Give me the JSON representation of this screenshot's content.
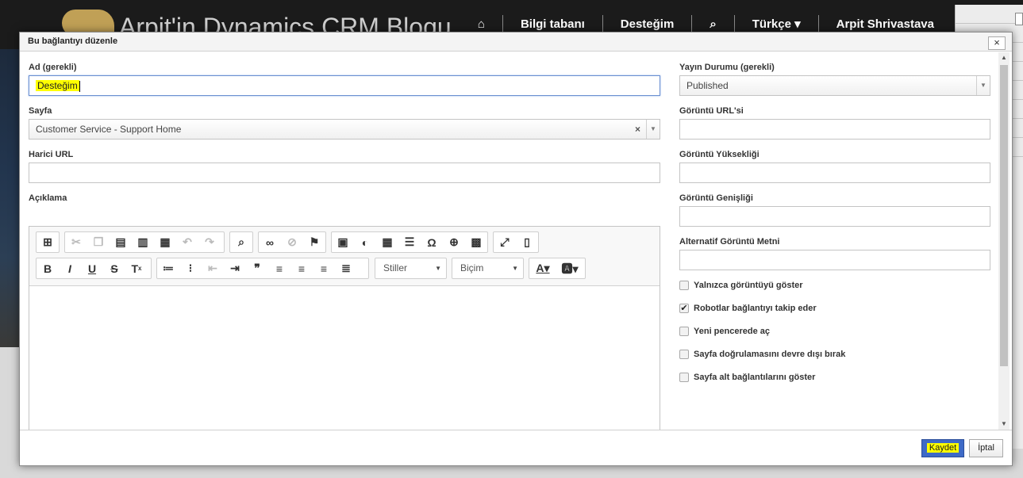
{
  "site": {
    "title": "Arpit'in Dynamics CRM Blogu",
    "nav": [
      "⌂",
      "Bilgi tabanı",
      "Desteğim",
      "⌕",
      "Türkçe ▾",
      "Arpit Shrivastava"
    ]
  },
  "dialog": {
    "title": "Bu bağlantıyı düzenle",
    "close": "×",
    "left": {
      "name_label": "Ad (gerekli)",
      "name_value": "Desteğim",
      "page_label": "Sayfa",
      "page_value": "Customer Service - Support Home",
      "page_clear": "×",
      "external_label": "Harici URL",
      "external_value": "",
      "description_label": "Açıklama"
    },
    "right": {
      "status_label": "Yayın Durumu (gerekli)",
      "status_value": "Published",
      "image_url_label": "Görüntü URL'si",
      "image_height_label": "Görüntü Yüksekliği",
      "image_width_label": "Görüntü Genişliği",
      "alt_text_label": "Alternatif Görüntü Metni",
      "checkboxes": [
        {
          "label": "Yalnızca görüntüyü göster",
          "checked": false
        },
        {
          "label": "Robotlar bağlantıyı takip eder",
          "checked": true
        },
        {
          "label": "Yeni pencerede aç",
          "checked": false
        },
        {
          "label": "Sayfa doğrulamasını devre dışı bırak",
          "checked": false
        },
        {
          "label": "Sayfa alt bağlantılarını göster",
          "checked": false
        }
      ]
    },
    "editor": {
      "styles_label": "Stiller",
      "format_label": "Biçim"
    },
    "footer": {
      "save_label": "Kaydet",
      "cancel_label": "İptal"
    }
  }
}
